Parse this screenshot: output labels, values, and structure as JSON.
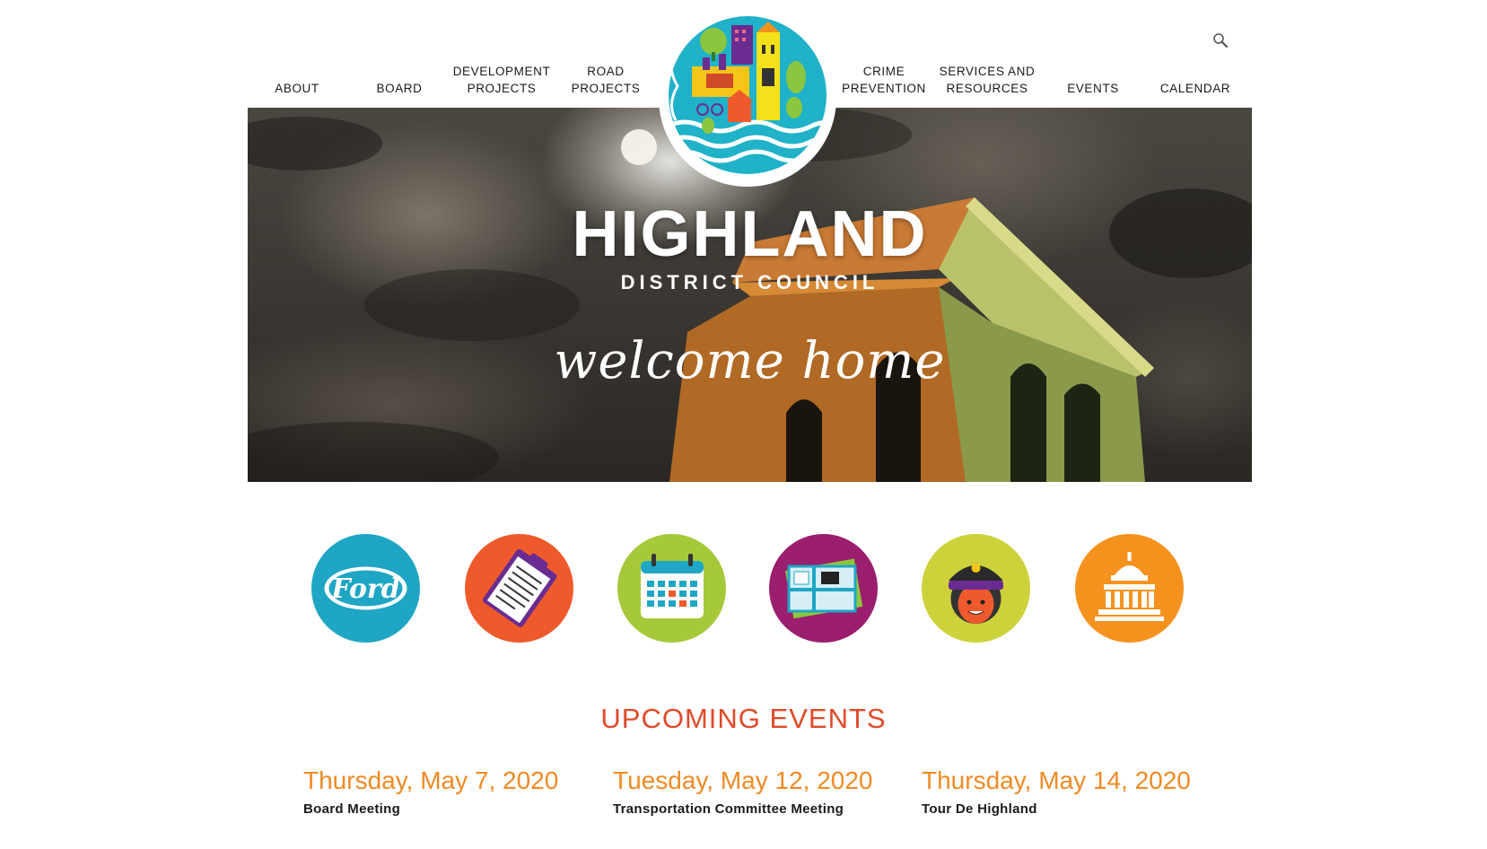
{
  "nav": {
    "left": [
      {
        "label": "ABOUT"
      },
      {
        "label": "BOARD"
      },
      {
        "label": "DEVELOPMENT\nPROJECTS"
      },
      {
        "label": "ROAD PROJECTS"
      }
    ],
    "right": [
      {
        "label": "CRIME\nPREVENTION"
      },
      {
        "label": "SERVICES AND\nRESOURCES"
      },
      {
        "label": "EVENTS"
      },
      {
        "label": "CALENDAR"
      }
    ],
    "search_icon": "search-icon"
  },
  "hero": {
    "title": "HIGHLAND",
    "subtitle": "DISTRICT COUNCIL",
    "tagline": "welcome home"
  },
  "quick_links": [
    {
      "icon": "ford-logo-icon",
      "color": "#1fa6c4"
    },
    {
      "icon": "clipboard-icon",
      "color": "#ef5a2c"
    },
    {
      "icon": "calendar-icon",
      "color": "#a6c93a"
    },
    {
      "icon": "map-icon",
      "color": "#9b1f6e"
    },
    {
      "icon": "police-officer-icon",
      "color": "#cdd23a"
    },
    {
      "icon": "capitol-building-icon",
      "color": "#f5921e"
    }
  ],
  "events": {
    "heading": "UPCOMING EVENTS",
    "items": [
      {
        "date": "Thursday, May 7, 2020",
        "title": "Board Meeting"
      },
      {
        "date": "Tuesday, May 12, 2020",
        "title": "Transportation Committee Meeting"
      },
      {
        "date": "Thursday, May 14, 2020",
        "title": "Tour De Highland"
      }
    ]
  },
  "colors": {
    "accent_red": "#e04a2a",
    "accent_orange": "#f08a24"
  }
}
